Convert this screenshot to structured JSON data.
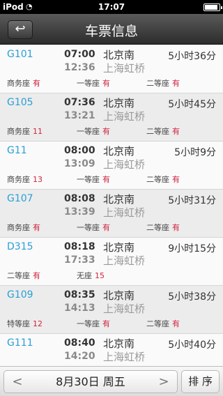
{
  "status": {
    "carrier": "iPod",
    "time": "17:07"
  },
  "nav": {
    "back_icon": "↩",
    "title": "车票信息"
  },
  "trains": [
    {
      "code": "G101",
      "depart": "07:00",
      "arrive": "12:36",
      "from": "北京南",
      "to": "上海虹桥",
      "duration": "5小时36分",
      "seats": [
        {
          "label": "商务座",
          "value": "有"
        },
        {
          "label": "一等座",
          "value": "有"
        },
        {
          "label": "二等座",
          "value": "有"
        }
      ]
    },
    {
      "code": "G105",
      "depart": "07:36",
      "arrive": "13:21",
      "from": "北京南",
      "to": "上海虹桥",
      "duration": "5小时45分",
      "seats": [
        {
          "label": "商务座",
          "value": "11"
        },
        {
          "label": "一等座",
          "value": "有"
        },
        {
          "label": "二等座",
          "value": "有"
        }
      ]
    },
    {
      "code": "G11",
      "depart": "08:00",
      "arrive": "13:09",
      "from": "北京南",
      "to": "上海虹桥",
      "duration": "5小时9分",
      "seats": [
        {
          "label": "商务座",
          "value": "13"
        },
        {
          "label": "一等座",
          "value": "有"
        },
        {
          "label": "二等座",
          "value": "有"
        }
      ]
    },
    {
      "code": "G107",
      "depart": "08:08",
      "arrive": "13:39",
      "from": "北京南",
      "to": "上海虹桥",
      "duration": "5小时31分",
      "seats": [
        {
          "label": "商务座",
          "value": "有"
        },
        {
          "label": "一等座",
          "value": "有"
        },
        {
          "label": "二等座",
          "value": "有"
        }
      ]
    },
    {
      "code": "D315",
      "depart": "08:18",
      "arrive": "17:33",
      "from": "北京南",
      "to": "上海虹桥",
      "duration": "9小时15分",
      "seats": [
        {
          "label": "二等座",
          "value": "有"
        },
        {
          "label": "无座",
          "value": "15"
        }
      ]
    },
    {
      "code": "G109",
      "depart": "08:35",
      "arrive": "14:13",
      "from": "北京南",
      "to": "上海虹桥",
      "duration": "5小时38分",
      "seats": [
        {
          "label": "特等座",
          "value": "12"
        },
        {
          "label": "一等座",
          "value": "有"
        },
        {
          "label": "二等座",
          "value": "有"
        }
      ]
    },
    {
      "code": "G111",
      "depart": "08:40",
      "arrive": "14:20",
      "from": "北京南",
      "to": "上海虹桥",
      "duration": "5小时40分",
      "seats": []
    }
  ],
  "bottom": {
    "prev_icon": "<",
    "date": "8月30日 周五",
    "next_icon": ">",
    "sort_label": "排 序"
  }
}
